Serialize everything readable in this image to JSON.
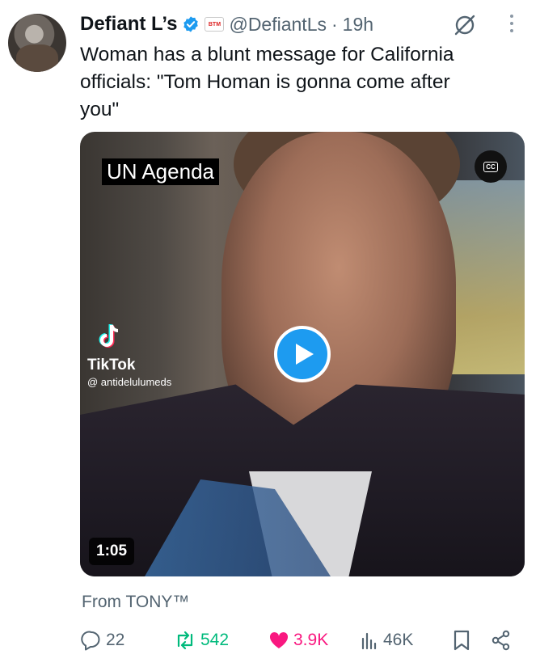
{
  "post": {
    "author_name": "Defiant L’s",
    "affiliate_badge": "BTM",
    "handle": "@DefiantLs",
    "separator": "·",
    "time": "19h",
    "text_lines": [
      "Woman has a blunt message for California",
      "officials: \"Tom Homan is gonna come after",
      "you\""
    ]
  },
  "media": {
    "caption": "UN Agenda",
    "cc_label": "CC",
    "tiktok_brand": "TikTok",
    "tiktok_user": "@ antidelulumeds",
    "duration": "1:05"
  },
  "source": "From TONY™",
  "actions": {
    "replies": "22",
    "reposts": "542",
    "likes": "3.9K",
    "views": "46K"
  },
  "colors": {
    "verified": "#1d9bf0",
    "repost": "#00ba7c",
    "like": "#f91880",
    "play": "#1d9bf0",
    "muted": "#536471"
  }
}
